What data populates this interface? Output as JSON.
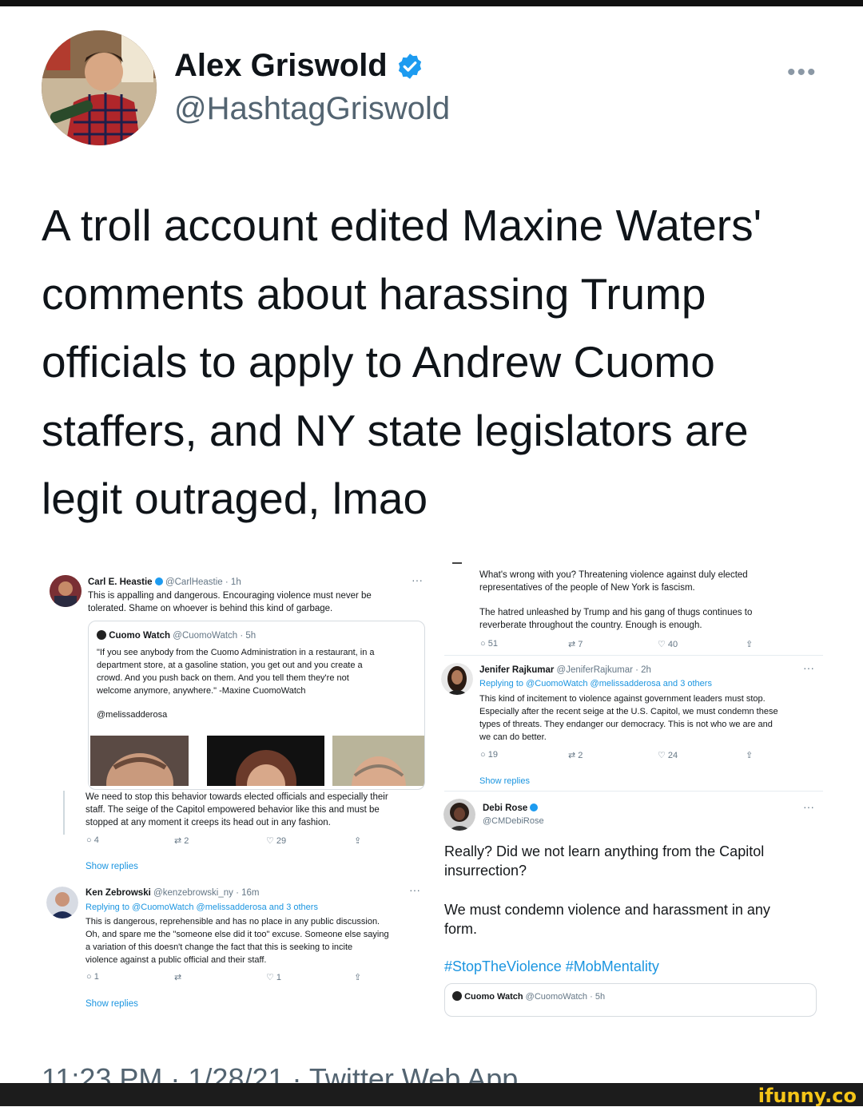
{
  "author": {
    "name": "Alex Griswold",
    "handle": "@HashtagGriswold"
  },
  "more_icon": "•••",
  "tweet_text": "A troll account edited Maxine Waters' comments about harassing Trump officials to apply to Andrew Cuomo staffers, and NY state legislators are legit outraged, lmao",
  "left": {
    "carl": {
      "name": "Carl E. Heastie",
      "handle": "@CarlHeastie · 1h",
      "text1": "This is appalling and dangerous. Encouraging violence must never be",
      "text2": "tolerated. Shame on whoever is behind this kind of garbage."
    },
    "quote": {
      "name": "Cuomo Watch",
      "handle": "@CuomoWatch · 5h",
      "lines": [
        "\"If you see anybody from the Cuomo Administration in a restaurant, in a",
        "department store, at a gasoline station, you get out and you create a",
        "crowd. And you push back on them. And you tell them they're not",
        "welcome anymore, anywhere.\" -Maxine CuomoWatch"
      ],
      "mention": "@melissadderosa"
    },
    "reply_text": [
      "We need to stop this behavior towards elected officials and especially their",
      "staff. The seige of the Capitol empowered behavior like this and must be",
      "stopped at any moment it creeps its head out in any fashion."
    ],
    "carl_counts": {
      "replies": "4",
      "retweets": "2",
      "likes": "29"
    },
    "show_replies_1": "Show replies",
    "ken": {
      "name": "Ken Zebrowski",
      "handle": "@kenzebrowski_ny · 16m",
      "replying": "Replying to @CuomoWatch @melissadderosa and 3 others",
      "lines": [
        "This is dangerous, reprehensible and has no place in any public discussion.",
        "Oh, and spare me the \"someone else did it too\" excuse. Someone else saying",
        "a variation of this doesn't change the fact that this is seeking to incite",
        "violence against a public official and their staff."
      ],
      "counts": {
        "replies": "1",
        "retweets": "",
        "likes": "1"
      }
    },
    "show_replies_2": "Show replies"
  },
  "right": {
    "top_lines": [
      "What's wrong with you? Threatening violence against duly elected",
      "representatives of the people of New York is fascism."
    ],
    "top_lines2": [
      "The hatred unleashed by Trump and his gang of thugs continues to",
      "reverberate throughout the country. Enough is enough."
    ],
    "top_counts": {
      "replies": "51",
      "retweets": "7",
      "likes": "40"
    },
    "jenifer": {
      "name": "Jenifer Rajkumar",
      "handle": "@JeniferRajkumar · 2h",
      "replying": "Replying to @CuomoWatch @melissadderosa and 3 others",
      "lines": [
        "This kind of incitement to violence against government leaders must stop.",
        "Especially after the recent seige at the U.S. Capitol, we must condemn these",
        "types of threats. They endanger our democracy. This is not who we are and",
        "we can do better."
      ],
      "counts": {
        "replies": "19",
        "retweets": "2",
        "likes": "24"
      }
    },
    "show_replies": "Show replies",
    "debi": {
      "name": "Debi Rose",
      "handle": "@CMDebiRose",
      "text1": "Really?  Did we not learn anything from the Capitol insurrection?",
      "text2": "We must condemn violence  and harassment in any form.",
      "hashtags": "#StopTheViolence #MobMentality"
    },
    "quote_small": {
      "name": "Cuomo Watch",
      "handle": "@CuomoWatch · 5h"
    }
  },
  "timestamp": "11:23 PM · 1/28/21 · Twitter Web App",
  "watermark": "ifunny.co",
  "colors": {
    "verified": "#1d9bf0",
    "link": "#1b95e0",
    "muted": "#536471"
  }
}
